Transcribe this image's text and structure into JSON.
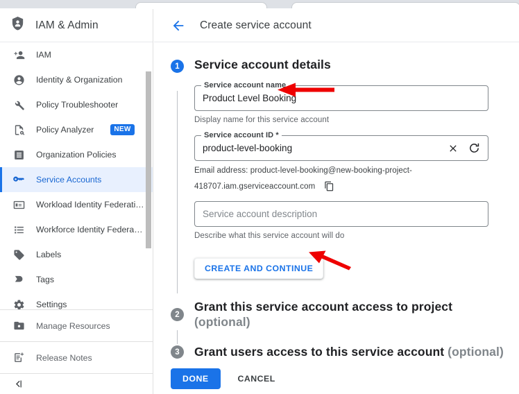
{
  "browser": {
    "tab_count": 2
  },
  "sidebar": {
    "header": {
      "title": "IAM & Admin",
      "icon": "shield-person-icon"
    },
    "items": [
      {
        "label": "IAM",
        "icon": "person-add-icon",
        "selected": false
      },
      {
        "label": "Identity & Organization",
        "icon": "account-circle-icon",
        "selected": false
      },
      {
        "label": "Policy Troubleshooter",
        "icon": "wrench-icon",
        "selected": false
      },
      {
        "label": "Policy Analyzer",
        "icon": "document-search-icon",
        "selected": false,
        "badge": "NEW"
      },
      {
        "label": "Organization Policies",
        "icon": "article-icon",
        "selected": false
      },
      {
        "label": "Service Accounts",
        "icon": "key-card-icon",
        "selected": true
      },
      {
        "label": "Workload Identity Federati…",
        "icon": "id-card-icon",
        "selected": false
      },
      {
        "label": "Workforce Identity Federa…",
        "icon": "list-icon",
        "selected": false
      },
      {
        "label": "Labels",
        "icon": "label-icon",
        "selected": false
      },
      {
        "label": "Tags",
        "icon": "tag-arrow-icon",
        "selected": false
      },
      {
        "label": "Settings",
        "icon": "settings-gear-icon",
        "selected": false
      }
    ],
    "bottom_items": [
      {
        "label": "Manage Resources",
        "icon": "folder-manage-icon"
      },
      {
        "label": "Release Notes",
        "icon": "release-notes-icon"
      }
    ],
    "collapse": {
      "label": "",
      "icon": "collapse-panel-icon"
    }
  },
  "main": {
    "header": {
      "title": "Create service account",
      "back_icon": "back-arrow-icon"
    },
    "step1": {
      "number": "1",
      "title": "Service account details",
      "name_field": {
        "label": "Service account name",
        "value": "Product Level Booking",
        "placeholder": "",
        "helper": "Display name for this service account"
      },
      "id_field": {
        "label": "Service account ID *",
        "value": "product-level-booking",
        "placeholder": "",
        "clear_icon": "clear-x-icon",
        "refresh_icon": "refresh-icon"
      },
      "email": {
        "line1": "Email address: product-level-booking@new-booking-project-",
        "line2": "418707.iam.gserviceaccount.com",
        "copy_icon": "copy-icon"
      },
      "description_field": {
        "label": "",
        "value": "",
        "placeholder": "Service account description",
        "helper": "Describe what this service account will do"
      },
      "create_button": "CREATE AND CONTINUE"
    },
    "step2": {
      "number": "2",
      "title": "Grant this service account access to project",
      "optional": "(optional)"
    },
    "step3": {
      "number": "3",
      "title": "Grant users access to this service account",
      "optional": "(optional)"
    },
    "footer": {
      "done": "DONE",
      "cancel": "CANCEL"
    }
  },
  "annotations": {
    "arrow_name_field": "red-arrow-pointing-left",
    "arrow_create_button": "red-arrow-pointing-upleft",
    "color": "#ee0000"
  },
  "colors": {
    "accent_blue": "#1a73e8",
    "selected_bg": "#e8f0fe",
    "selected_text": "#1967d2",
    "text_primary": "#202124",
    "text_secondary": "#5f6368",
    "annotation_red": "#ee0000"
  }
}
